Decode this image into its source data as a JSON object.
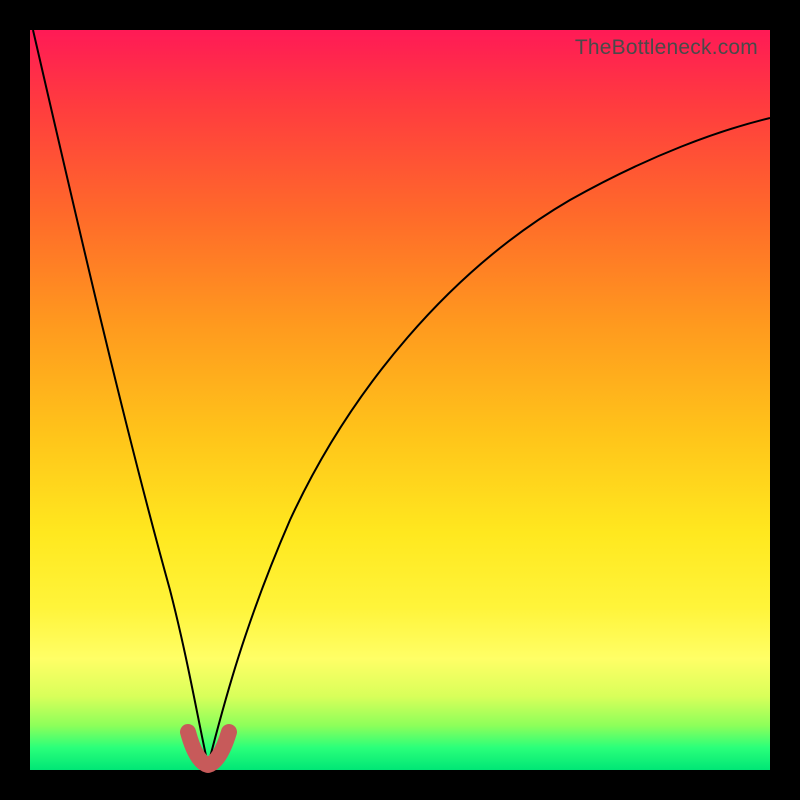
{
  "watermark": "TheBottleneck.com",
  "colors": {
    "gradient_top": "#ff1a56",
    "gradient_bottom": "#00e676",
    "curve": "#000000",
    "dip_marker": "#c75a5a",
    "frame": "#000000"
  },
  "chart_data": {
    "type": "line",
    "title": "",
    "xlabel": "",
    "ylabel": "",
    "xlim": [
      0,
      100
    ],
    "ylim": [
      0,
      100
    ],
    "minimum_x": 24,
    "series": [
      {
        "name": "left-branch",
        "x": [
          0,
          4,
          8,
          12,
          16,
          20,
          22,
          24
        ],
        "values": [
          100,
          80,
          62,
          45,
          30,
          15,
          6,
          0
        ]
      },
      {
        "name": "right-branch",
        "x": [
          24,
          26,
          30,
          35,
          40,
          50,
          60,
          70,
          80,
          90,
          100
        ],
        "values": [
          0,
          6,
          18,
          32,
          43,
          58,
          68,
          75,
          80,
          83,
          85
        ]
      }
    ],
    "dip_marker": {
      "x_range": [
        21,
        27
      ],
      "y": 3
    }
  }
}
